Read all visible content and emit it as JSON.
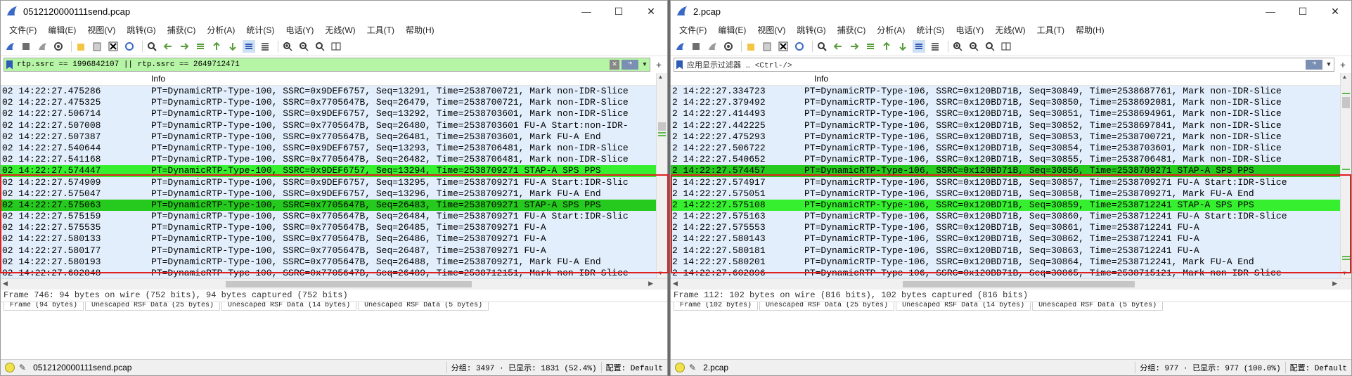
{
  "colors": {
    "row_default": "#e2eefc",
    "row_selected": "#26c91d",
    "row_highlight": "#36f030",
    "filter_applied": "#b7f5a6",
    "annotation": "#e02020"
  },
  "menu": [
    "文件(F)",
    "编辑(E)",
    "视图(V)",
    "跳转(G)",
    "捕获(C)",
    "分析(A)",
    "统计(S)",
    "电话(Y)",
    "无线(W)",
    "工具(T)",
    "帮助(H)"
  ],
  "window_controls": {
    "minimize": "—",
    "maximize": "☐",
    "close": "✕"
  },
  "left": {
    "title": "0512120000111send.pcap",
    "filter": "rtp.ssrc == 1996842107 || rtp.ssrc == 2649712471",
    "column_info": "Info",
    "rows": [
      {
        "time": "02 14:22:27.475286",
        "info": "PT=DynamicRTP-Type-100, SSRC=0x9DEF6757, Seq=13291, Time=2538700721, Mark non-IDR-Slice",
        "style": "default"
      },
      {
        "time": "02 14:22:27.475325",
        "info": "PT=DynamicRTP-Type-100, SSRC=0x7705647B, Seq=26479, Time=2538700721, Mark non-IDR-Slice",
        "style": "default"
      },
      {
        "time": "02 14:22:27.506714",
        "info": "PT=DynamicRTP-Type-100, SSRC=0x9DEF6757, Seq=13292, Time=2538703601, Mark non-IDR-Slice",
        "style": "default"
      },
      {
        "time": "02 14:22:27.507008",
        "info": "PT=DynamicRTP-Type-100, SSRC=0x7705647B, Seq=26480, Time=2538703601 FU-A Start:non-IDR-",
        "style": "default"
      },
      {
        "time": "02 14:22:27.507387",
        "info": "PT=DynamicRTP-Type-100, SSRC=0x7705647B, Seq=26481, Time=2538703601, Mark FU-A End",
        "style": "default"
      },
      {
        "time": "02 14:22:27.540644",
        "info": "PT=DynamicRTP-Type-100, SSRC=0x9DEF6757, Seq=13293, Time=2538706481, Mark non-IDR-Slice",
        "style": "default"
      },
      {
        "time": "02 14:22:27.541168",
        "info": "PT=DynamicRTP-Type-100, SSRC=0x7705647B, Seq=26482, Time=2538706481, Mark non-IDR-Slice",
        "style": "default"
      },
      {
        "time": "02 14:22:27.574447",
        "info": "PT=DynamicRTP-Type-100, SSRC=0x9DEF6757, Seq=13294, Time=2538709271 STAP-A SPS PPS",
        "style": "highlight"
      },
      {
        "time": "02 14:22:27.574909",
        "info": "PT=DynamicRTP-Type-100, SSRC=0x9DEF6757, Seq=13295, Time=2538709271 FU-A Start:IDR-Slic",
        "style": "default"
      },
      {
        "time": "02 14:22:27.575047",
        "info": "PT=DynamicRTP-Type-100, SSRC=0x9DEF6757, Seq=13296, Time=2538709271, Mark FU-A End",
        "style": "default"
      },
      {
        "time": "02 14:22:27.575063",
        "info": "PT=DynamicRTP-Type-100, SSRC=0x7705647B, Seq=26483, Time=2538709271 STAP-A SPS PPS",
        "style": "selected"
      },
      {
        "time": "02 14:22:27.575159",
        "info": "PT=DynamicRTP-Type-100, SSRC=0x7705647B, Seq=26484, Time=2538709271 FU-A Start:IDR-Slic",
        "style": "default"
      },
      {
        "time": "02 14:22:27.575535",
        "info": "PT=DynamicRTP-Type-100, SSRC=0x7705647B, Seq=26485, Time=2538709271 FU-A",
        "style": "default"
      },
      {
        "time": "02 14:22:27.580133",
        "info": "PT=DynamicRTP-Type-100, SSRC=0x7705647B, Seq=26486, Time=2538709271 FU-A",
        "style": "default"
      },
      {
        "time": "02 14:22:27.580177",
        "info": "PT=DynamicRTP-Type-100, SSRC=0x7705647B, Seq=26487, Time=2538709271 FU-A",
        "style": "default"
      },
      {
        "time": "02 14:22:27.580193",
        "info": "PT=DynamicRTP-Type-100, SSRC=0x7705647B, Seq=26488, Time=2538709271, Mark FU-A End",
        "style": "default"
      },
      {
        "time": "02 14:22:27.602848",
        "info": "PT=DynamicRTP-Type-100, SSRC=0x7705647B, Seq=26489, Time=2538712151, Mark non-IDR-Slice",
        "style": "default"
      }
    ],
    "detail": "Frame 746: 94 bytes on wire (752 bits), 94 bytes captured (752 bits)",
    "byte_tabs": [
      "Frame (94 bytes)",
      "Unescaped RSF Data (25 bytes)",
      "Unescaped RSF Data (14 bytes)",
      "Unescaped RSF Data (5 bytes)"
    ],
    "status_file": "0512120000111send.pcap",
    "status_stats": "分组: 3497 · 已显示: 1831 (52.4%)",
    "status_profile": "配置: Default"
  },
  "right": {
    "title": "2.pcap",
    "filter_placeholder": "应用显示过滤器 … <Ctrl-/>",
    "column_info": "Info",
    "rows": [
      {
        "time": "2 14:22:27.334723",
        "info": "PT=DynamicRTP-Type-106, SSRC=0x120BD71B, Seq=30849, Time=2538687761, Mark non-IDR-Slice",
        "style": "default"
      },
      {
        "time": "2 14:22:27.379492",
        "info": "PT=DynamicRTP-Type-106, SSRC=0x120BD71B, Seq=30850, Time=2538692081, Mark non-IDR-Slice",
        "style": "default"
      },
      {
        "time": "2 14:22:27.414493",
        "info": "PT=DynamicRTP-Type-106, SSRC=0x120BD71B, Seq=30851, Time=2538694961, Mark non-IDR-Slice",
        "style": "default"
      },
      {
        "time": "2 14:22:27.442225",
        "info": "PT=DynamicRTP-Type-106, SSRC=0x120BD71B, Seq=30852, Time=2538697841, Mark non-IDR-Slice",
        "style": "default"
      },
      {
        "time": "2 14:22:27.475293",
        "info": "PT=DynamicRTP-Type-106, SSRC=0x120BD71B, Seq=30853, Time=2538700721, Mark non-IDR-Slice",
        "style": "default"
      },
      {
        "time": "2 14:22:27.506722",
        "info": "PT=DynamicRTP-Type-106, SSRC=0x120BD71B, Seq=30854, Time=2538703601, Mark non-IDR-Slice",
        "style": "default"
      },
      {
        "time": "2 14:22:27.540652",
        "info": "PT=DynamicRTP-Type-106, SSRC=0x120BD71B, Seq=30855, Time=2538706481, Mark non-IDR-Slice",
        "style": "default"
      },
      {
        "time": "2 14:22:27.574457",
        "info": "PT=DynamicRTP-Type-106, SSRC=0x120BD71B, Seq=30856, Time=2538709271 STAP-A SPS PPS",
        "style": "selected"
      },
      {
        "time": "2 14:22:27.574917",
        "info": "PT=DynamicRTP-Type-106, SSRC=0x120BD71B, Seq=30857, Time=2538709271 FU-A Start:IDR-Slice",
        "style": "default"
      },
      {
        "time": "2 14:22:27.575051",
        "info": "PT=DynamicRTP-Type-106, SSRC=0x120BD71B, Seq=30858, Time=2538709271, Mark FU-A End",
        "style": "default"
      },
      {
        "time": "2 14:22:27.575108",
        "info": "PT=DynamicRTP-Type-106, SSRC=0x120BD71B, Seq=30859, Time=2538712241 STAP-A SPS PPS",
        "style": "highlight"
      },
      {
        "time": "2 14:22:27.575163",
        "info": "PT=DynamicRTP-Type-106, SSRC=0x120BD71B, Seq=30860, Time=2538712241 FU-A Start:IDR-Slice",
        "style": "default"
      },
      {
        "time": "2 14:22:27.575553",
        "info": "PT=DynamicRTP-Type-106, SSRC=0x120BD71B, Seq=30861, Time=2538712241 FU-A",
        "style": "default"
      },
      {
        "time": "2 14:22:27.580143",
        "info": "PT=DynamicRTP-Type-106, SSRC=0x120BD71B, Seq=30862, Time=2538712241 FU-A",
        "style": "default"
      },
      {
        "time": "2 14:22:27.580181",
        "info": "PT=DynamicRTP-Type-106, SSRC=0x120BD71B, Seq=30863, Time=2538712241 FU-A",
        "style": "default"
      },
      {
        "time": "2 14:22:27.580201",
        "info": "PT=DynamicRTP-Type-106, SSRC=0x120BD71B, Seq=30864, Time=2538712241, Mark FU-A End",
        "style": "default"
      },
      {
        "time": "2 14:22:27.602896",
        "info": "PT=DynamicRTP-Type-106, SSRC=0x120BD71B, Seq=30865, Time=2538715121, Mark non-IDR-Slice",
        "style": "default"
      }
    ],
    "detail": "Frame 112: 102 bytes on wire (816 bits), 102 bytes captured (816 bits)",
    "byte_tabs": [
      "Frame (102 bytes)",
      "Unescaped RSF Data (25 bytes)",
      "Unescaped RSF Data (14 bytes)",
      "Unescaped RSF Data (5 bytes)"
    ],
    "status_file": "2.pcap",
    "status_stats": "分组: 977 · 已显示: 977 (100.0%)",
    "status_profile": "配置: Default"
  }
}
